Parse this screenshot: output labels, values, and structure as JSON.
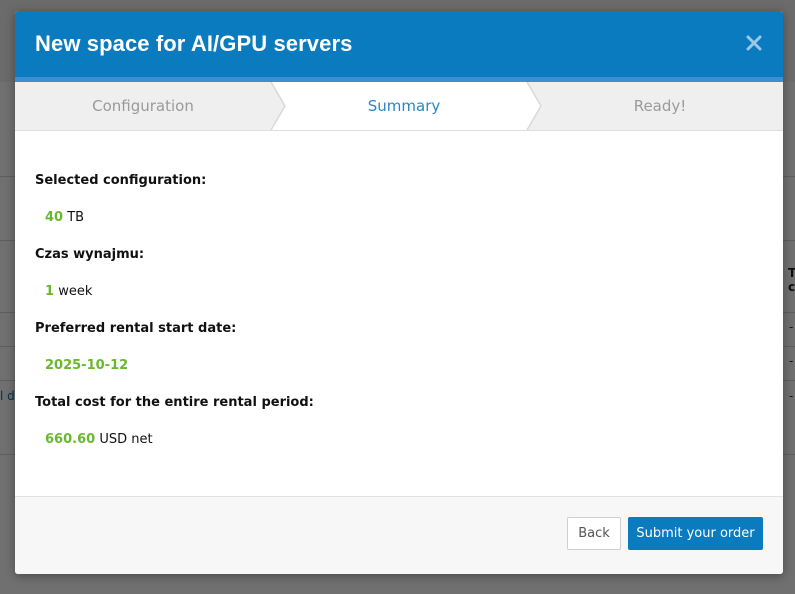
{
  "background": {
    "column_header_line1": "T",
    "column_header_line2": "c",
    "dash": "-",
    "link_fragment": "l d"
  },
  "modal": {
    "title": "New space for AI/GPU servers",
    "close_icon": "close-icon"
  },
  "steps": [
    {
      "label": "Configuration",
      "state": "completed"
    },
    {
      "label": "Summary",
      "state": "active"
    },
    {
      "label": "Ready!",
      "state": "pending"
    }
  ],
  "summary": {
    "configuration": {
      "label": "Selected configuration:",
      "value": "40",
      "unit": "TB"
    },
    "rental_time": {
      "label": "Czas wynajmu:",
      "value": "1",
      "unit": "week"
    },
    "start_date": {
      "label": "Preferred rental start date:",
      "value": "2025-10-12"
    },
    "total_cost": {
      "label": "Total cost for the entire rental period:",
      "value": "660.60",
      "unit": "USD net"
    }
  },
  "footer": {
    "back_label": "Back",
    "submit_label": "Submit your order"
  },
  "colors": {
    "header": "#0a7bbf",
    "header_accent": "#3b91cf",
    "active_step": "#2a86c8",
    "inactive_step": "#9a9a9a",
    "value_green": "#6ab82e",
    "overlay": "#000000"
  }
}
